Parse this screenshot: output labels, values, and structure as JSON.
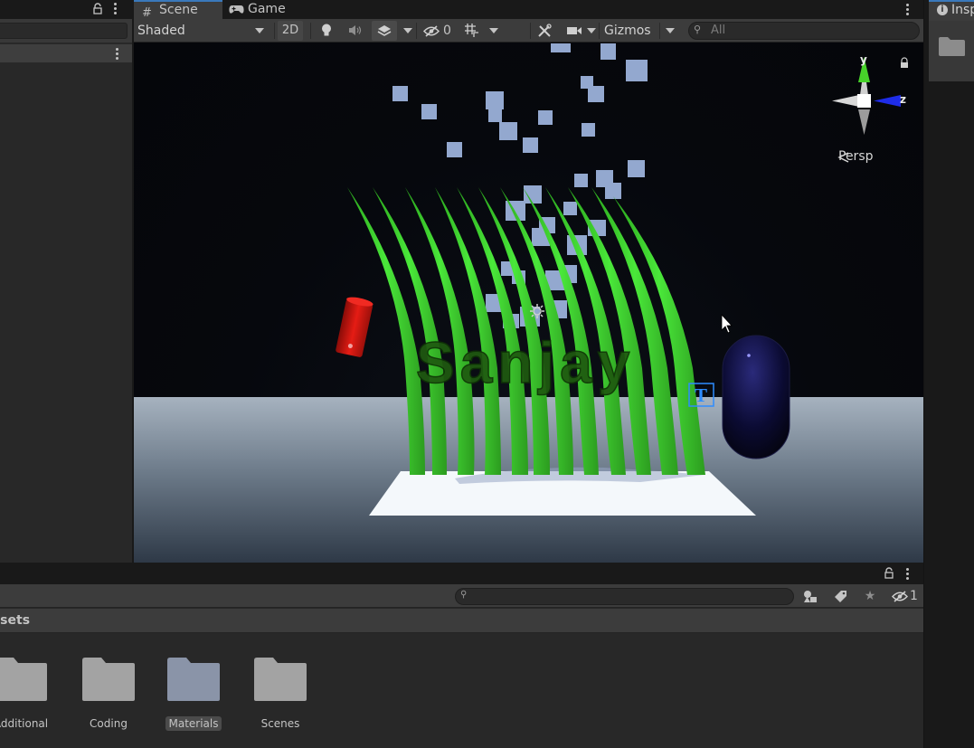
{
  "scene_tabs": [
    {
      "label": "Scene",
      "icon": "#",
      "active": true
    },
    {
      "label": "Game",
      "icon": "game-controller-icon",
      "active": false
    }
  ],
  "toolbar": {
    "shading_mode": "Shaded",
    "two_d_label": "2D",
    "hidden_count": "0",
    "gizmos_label": "Gizmos",
    "search_placeholder": "All"
  },
  "viewport": {
    "object_text": "Sanjay",
    "text_icon_letter": "T",
    "persp_label": "Persp",
    "axis_y": "y",
    "axis_z": "z",
    "text_color": "#1f5a10",
    "grass_color": "#3fd62f",
    "capsule_color": "#0c0c3c",
    "cube_color": "#93a8cf",
    "red_cylinder_color": "#d81a12"
  },
  "inspector": {
    "tab_label": "Inspector"
  },
  "project": {
    "breadcrumb": "Assets",
    "search_placeholder": "",
    "hidden_packages_count": "1",
    "folders": [
      {
        "name": "Additional",
        "selected": false
      },
      {
        "name": "Coding",
        "selected": false
      },
      {
        "name": "Materials",
        "selected": true
      },
      {
        "name": "Scenes",
        "selected": false
      }
    ]
  },
  "colors": {
    "accent": "#3a79bb",
    "panel": "#282828",
    "toolbar": "#3c3c3c"
  }
}
